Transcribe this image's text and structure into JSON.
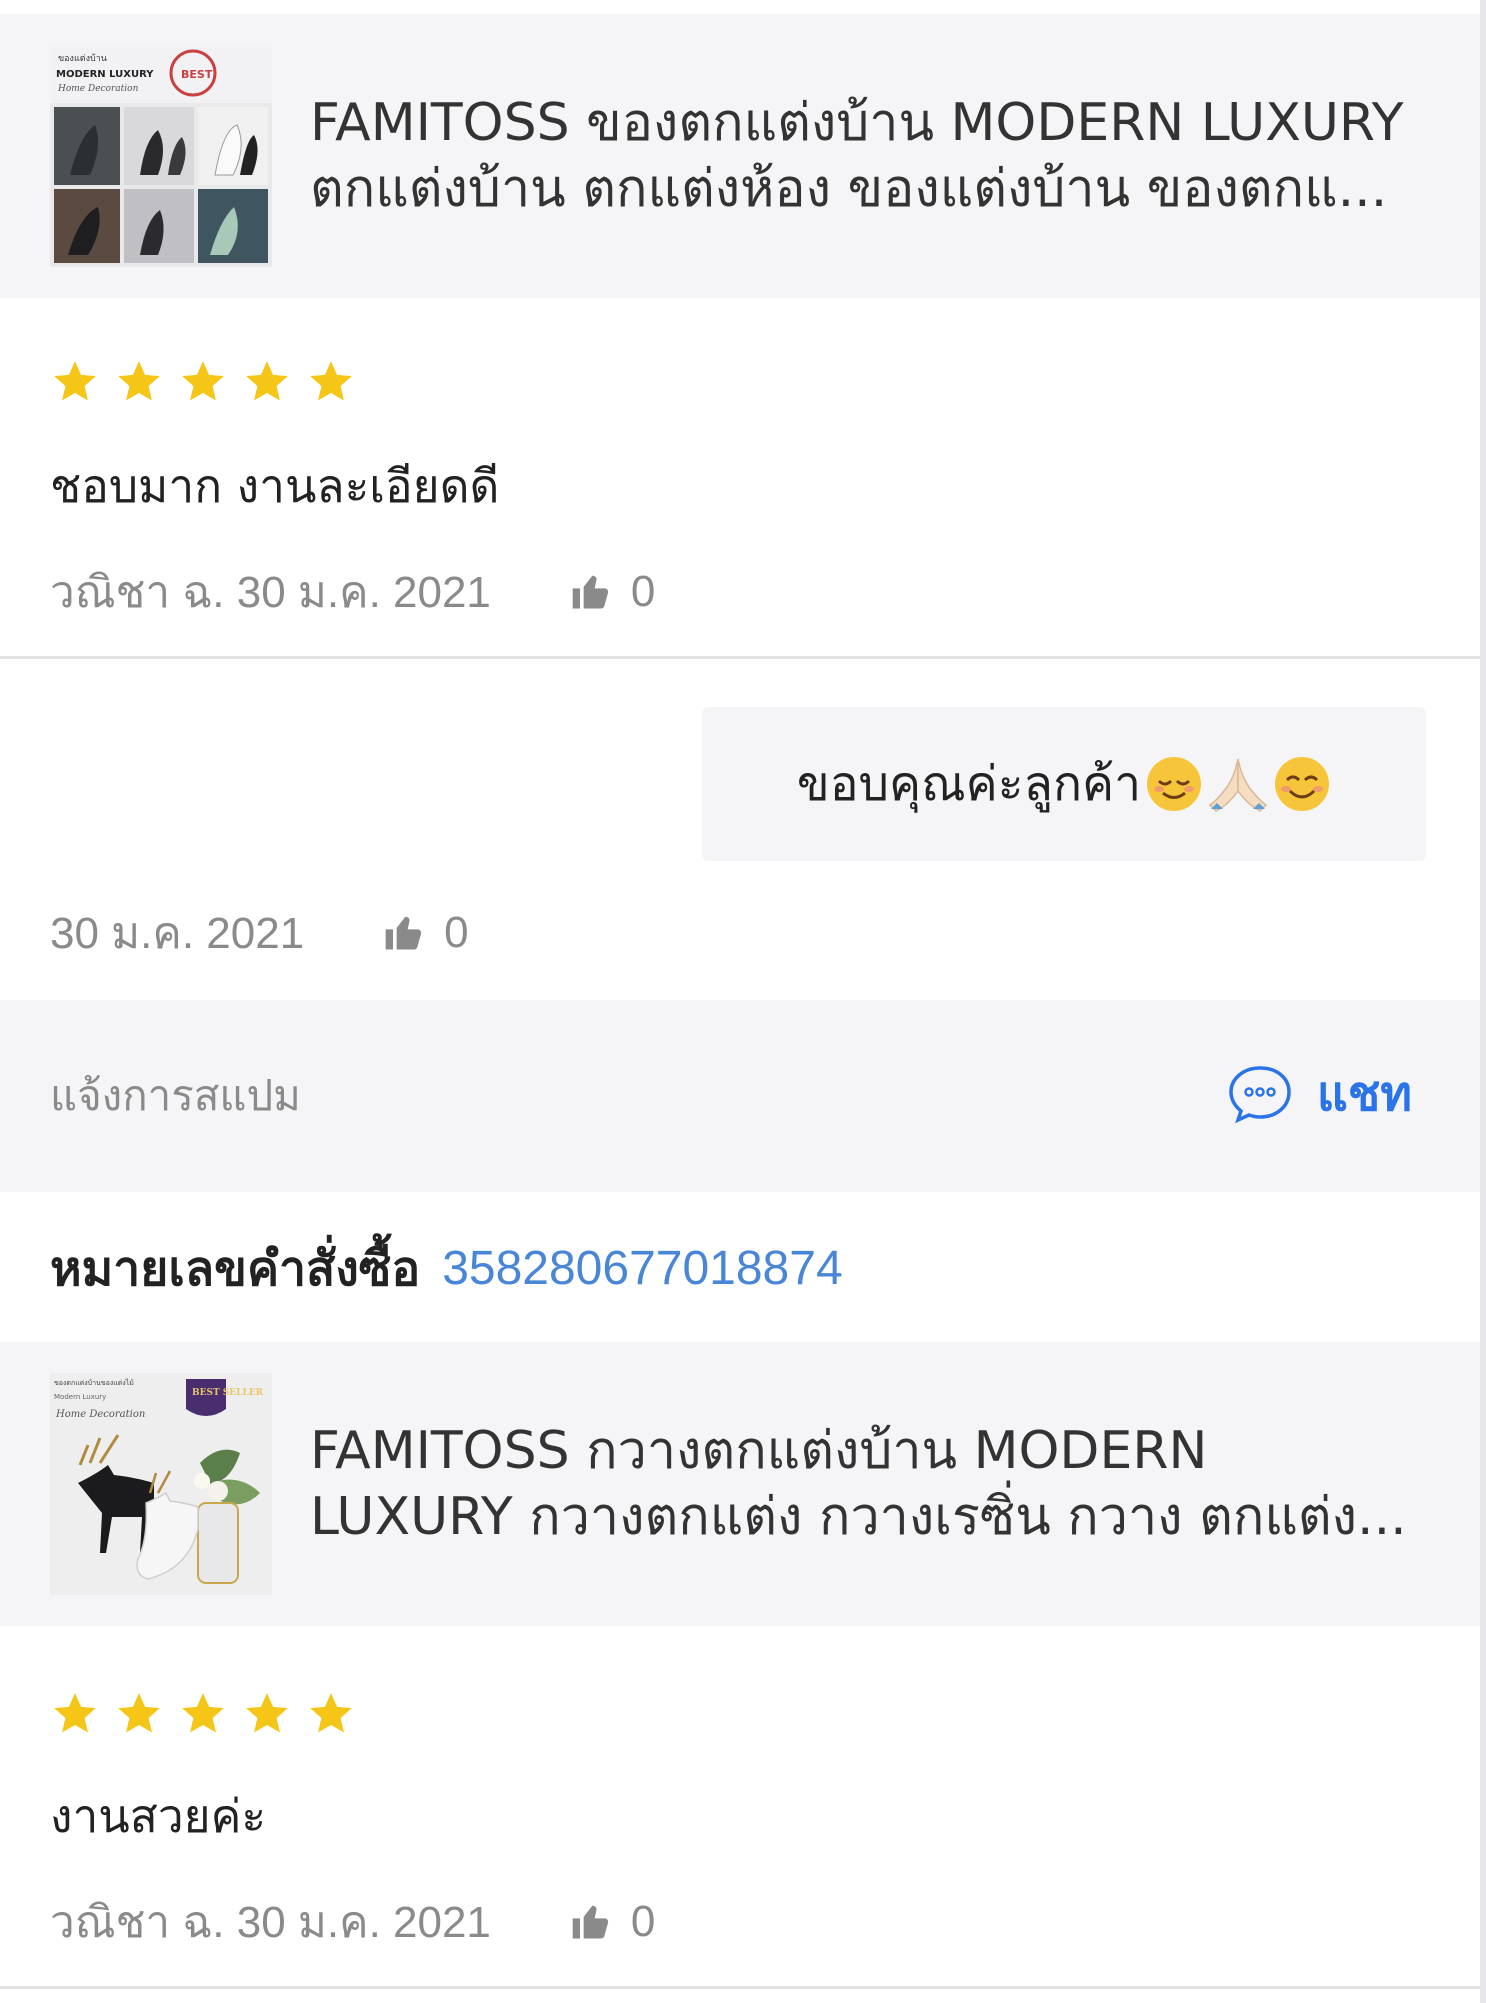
{
  "colors": {
    "panel_bg": "#f5f5f7",
    "star": "#f5c518",
    "link_blue": "#2a73e8",
    "order_blue": "#4a86d6",
    "muted": "#8a8a8a"
  },
  "reviews": [
    {
      "product": {
        "title": "FAMITOSS  ของตกแต่งบ้าน MODERN LUXURY ตกแต่งบ้าน ตกแต่งห้อง ของแต่งบ้าน ของตกแ...",
        "thumb_caption": "ของแต่งบ้าน MODERN LUXURY Home Decoration",
        "thumb_badge": "BEST"
      },
      "rating": 5,
      "text": "ชอบมาก งานละเอียดดี",
      "author_date": "วณิชา ฉ. 30 ม.ค. 2021",
      "likes": "0",
      "seller_reply": {
        "text": "ขอบคุณค่ะลูกค้า",
        "emojis": [
          "relieved-face-icon",
          "folded-hands-icon",
          "smiling-face-icon"
        ],
        "date": "30 ม.ค. 2021",
        "likes": "0"
      }
    },
    {
      "product": {
        "title": "FAMITOSS กวางตกแต่งบ้าน MODERN LUXURY กวางตกแต่ง กวางเรซิ่น กวาง ตกแต่ง...",
        "thumb_caption": "ของตกแต่งบ้านของแต่งไม้ Home Decoration",
        "thumb_badge": "BEST SELLER"
      },
      "rating": 5,
      "text": "งานสวยค่ะ",
      "author_date": "วณิชา ฉ. 30 ม.ค. 2021",
      "likes": "0"
    }
  ],
  "actions": {
    "report_spam": "แจ้งการสแปม",
    "chat": "แชท"
  },
  "order": {
    "label": "หมายเลขคำสั่งซื้อ",
    "number": "358280677018874"
  }
}
